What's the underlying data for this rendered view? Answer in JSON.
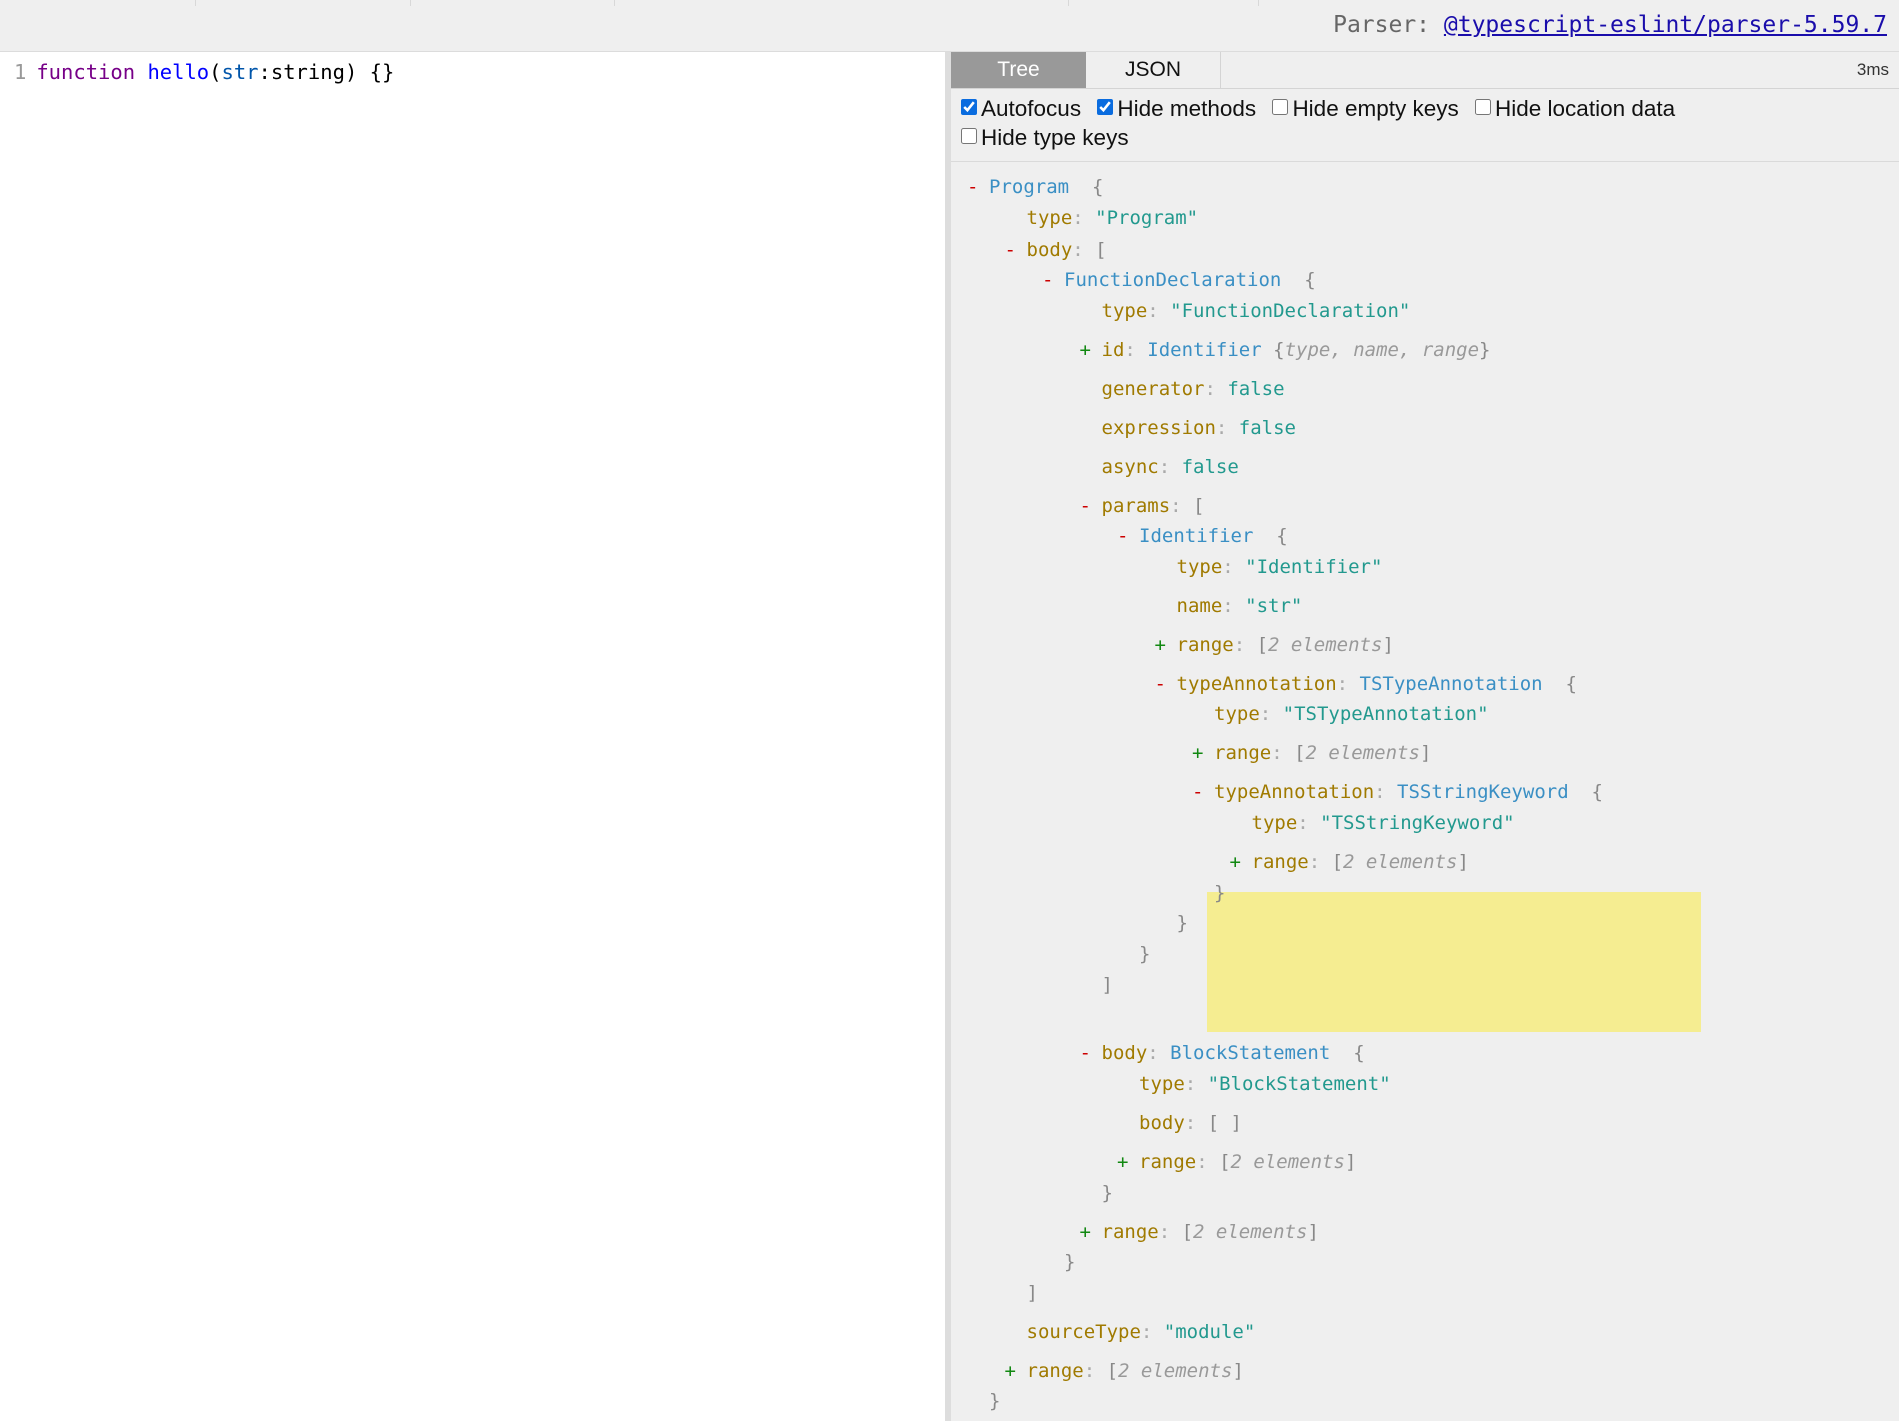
{
  "header": {
    "parser_label": "Parser:",
    "parser_link": "@typescript-eslint/parser-5.59.7"
  },
  "editor": {
    "line_number": "1",
    "code": {
      "keyword": "function",
      "fn_name": "hello",
      "open_paren": "(",
      "param": "str",
      "colon": ":",
      "type": "string",
      "rest": ") {}"
    }
  },
  "output": {
    "tabs": [
      {
        "label": "Tree",
        "active": true
      },
      {
        "label": "JSON",
        "active": false
      }
    ],
    "timing": "3ms",
    "options": [
      {
        "label": "Autofocus",
        "checked": true
      },
      {
        "label": "Hide methods",
        "checked": true
      },
      {
        "label": "Hide empty keys",
        "checked": false
      },
      {
        "label": "Hide location data",
        "checked": false
      },
      {
        "label": "Hide type keys",
        "checked": false
      }
    ],
    "highlight_color": "#f5ed91"
  },
  "tree": {
    "lines": [
      {
        "toggle": "-",
        "type_name": "Program",
        "bracket": "{"
      },
      {
        "key": "type",
        "value": "\"Program\""
      },
      {
        "toggle": "-",
        "key": "body",
        "bracket": "["
      },
      {
        "toggle": "-",
        "type_name": "FunctionDeclaration",
        "bracket": "{"
      },
      {
        "key": "type",
        "value": "\"FunctionDeclaration\""
      },
      {
        "toggle": "+",
        "key": "id",
        "type_name": "Identifier",
        "bracket": "{",
        "summary": "type, name, range",
        "close": "}"
      },
      {
        "key": "generator",
        "value": "false"
      },
      {
        "key": "expression",
        "value": "false"
      },
      {
        "key": "async",
        "value": "false"
      },
      {
        "toggle": "-",
        "key": "params",
        "bracket": "["
      },
      {
        "toggle": "-",
        "type_name": "Identifier",
        "bracket": "{"
      },
      {
        "key": "type",
        "value": "\"Identifier\""
      },
      {
        "key": "name",
        "value": "\"str\""
      },
      {
        "toggle": "+",
        "key": "range",
        "bracket": "[",
        "summary": "2 elements",
        "close": "]"
      },
      {
        "toggle": "-",
        "key": "typeAnnotation",
        "type_name": "TSTypeAnnotation",
        "bracket": "{"
      },
      {
        "key": "type",
        "value": "\"TSTypeAnnotation\""
      },
      {
        "toggle": "+",
        "key": "range",
        "bracket": "[",
        "summary": "2 elements",
        "close": "]"
      },
      {
        "toggle": "-",
        "key": "typeAnnotation",
        "type_name": "TSStringKeyword",
        "bracket": "{"
      },
      {
        "key": "type",
        "value": "\"TSStringKeyword\""
      },
      {
        "toggle": "+",
        "key": "range",
        "bracket": "[",
        "summary": "2 elements",
        "close": "]"
      },
      {
        "close": "}"
      },
      {
        "close": "}"
      },
      {
        "close": "}"
      },
      {
        "close": "]"
      },
      {
        "toggle": "-",
        "key": "body",
        "type_name": "BlockStatement",
        "bracket": "{"
      },
      {
        "key": "type",
        "value": "\"BlockStatement\""
      },
      {
        "key": "body",
        "value": "[ ]"
      },
      {
        "toggle": "+",
        "key": "range",
        "bracket": "[",
        "summary": "2 elements",
        "close": "]"
      },
      {
        "close": "}"
      },
      {
        "toggle": "+",
        "key": "range",
        "bracket": "[",
        "summary": "2 elements",
        "close": "]"
      },
      {
        "close": "}"
      },
      {
        "close": "]"
      },
      {
        "key": "sourceType",
        "value": "\"module\""
      },
      {
        "toggle": "+",
        "key": "range",
        "bracket": "[",
        "summary": "2 elements",
        "close": "]"
      },
      {
        "close": "}"
      }
    ]
  }
}
